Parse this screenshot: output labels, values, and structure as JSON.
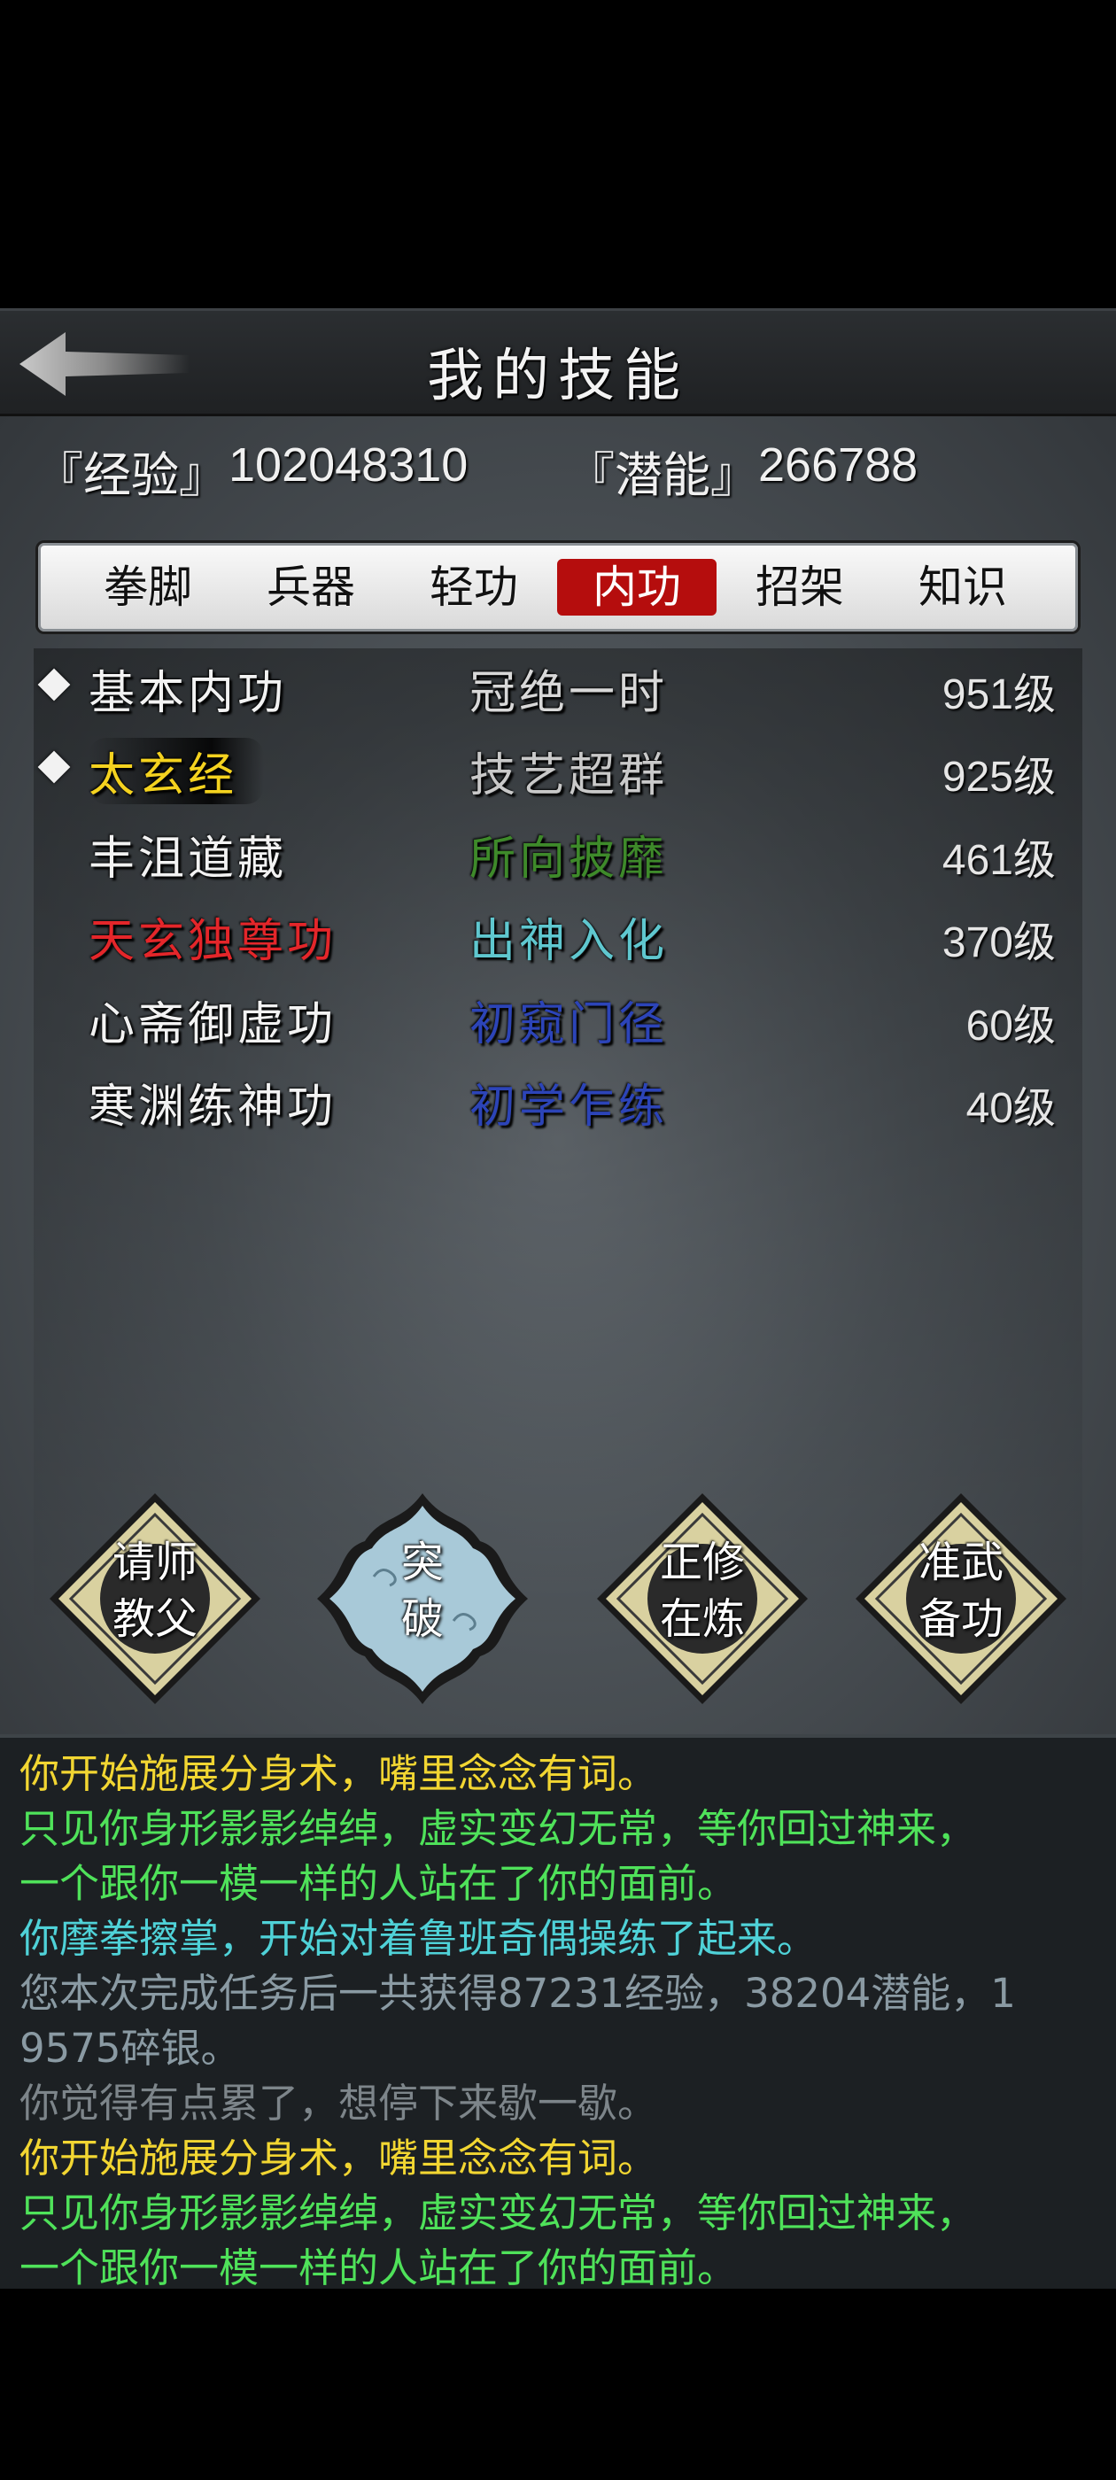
{
  "header": {
    "title": "我的技能"
  },
  "stats": {
    "exp_label": "『经验』",
    "exp_value": "102048310",
    "pot_label": "『潜能』",
    "pot_value": "266788"
  },
  "tabs": [
    {
      "label": "拳脚",
      "active": false
    },
    {
      "label": "兵器",
      "active": false
    },
    {
      "label": "轻功",
      "active": false
    },
    {
      "label": "内功",
      "active": true
    },
    {
      "label": "招架",
      "active": false
    },
    {
      "label": "知识",
      "active": false
    }
  ],
  "skills": [
    {
      "name": "基本内功",
      "name_color": "#f2f2f2",
      "level_text": "冠绝一时",
      "level_color": "#d8d8d8",
      "grade": "951级",
      "marked": true
    },
    {
      "name": "太玄经",
      "name_color": "#f4d21f",
      "level_text": "技艺超群",
      "level_color": "#c9c9c9",
      "grade": "925级",
      "marked": true
    },
    {
      "name": "丰沮道藏",
      "name_color": "#f2f2f2",
      "level_text": "所向披靡",
      "level_color": "#3e8a2a",
      "grade": "461级",
      "marked": false
    },
    {
      "name": "天玄独尊功",
      "name_color": "#e4262a",
      "level_text": "出神入化",
      "level_color": "#5fc7cf",
      "grade": "370级",
      "marked": false
    },
    {
      "name": "心斋御虚功",
      "name_color": "#f2f2f2",
      "level_text": "初窥门径",
      "level_color": "#2c44b8",
      "grade": "60级",
      "marked": false
    },
    {
      "name": "寒渊练神功",
      "name_color": "#f2f2f2",
      "level_text": "初学乍练",
      "level_color": "#2c44b8",
      "grade": "40级",
      "marked": false
    }
  ],
  "actions": [
    {
      "line1": "请师",
      "line2": "教父"
    },
    {
      "line1": "突",
      "line2": "破"
    },
    {
      "line1": "正修",
      "line2": "在炼"
    },
    {
      "line1": "准武",
      "line2": "备功"
    }
  ],
  "log": [
    {
      "text": "你开始施展分身术，嘴里念念有词。",
      "color": "#f2d632"
    },
    {
      "text": "只见你身形影影绰绰，虚实变幻无常，等你回过神来，",
      "color": "#4fe25a"
    },
    {
      "text": "一个跟你一模一样的人站在了你的面前。",
      "color": "#4fe25a"
    },
    {
      "text": "你摩拳擦掌，开始对着鲁班奇偶操练了起来。",
      "color": "#4fd2d8"
    },
    {
      "text": "您本次完成任务后一共获得87231经验，38204潜能，1",
      "color": "#8a9aa3"
    },
    {
      "text": "9575碎银。",
      "color": "#8a9aa3"
    },
    {
      "text": "你觉得有点累了，想停下来歇一歇。",
      "color": "#7d858a"
    },
    {
      "text": "你开始施展分身术，嘴里念念有词。",
      "color": "#f2d632"
    },
    {
      "text": "只见你身形影影绰绰，虚实变幻无常，等你回过神来，",
      "color": "#4fe25a"
    },
    {
      "text": "一个跟你一模一样的人站在了你的面前。",
      "color": "#4fe25a"
    }
  ],
  "icons": {
    "back": "back-arrow-icon",
    "marker": "diamond-icon"
  }
}
